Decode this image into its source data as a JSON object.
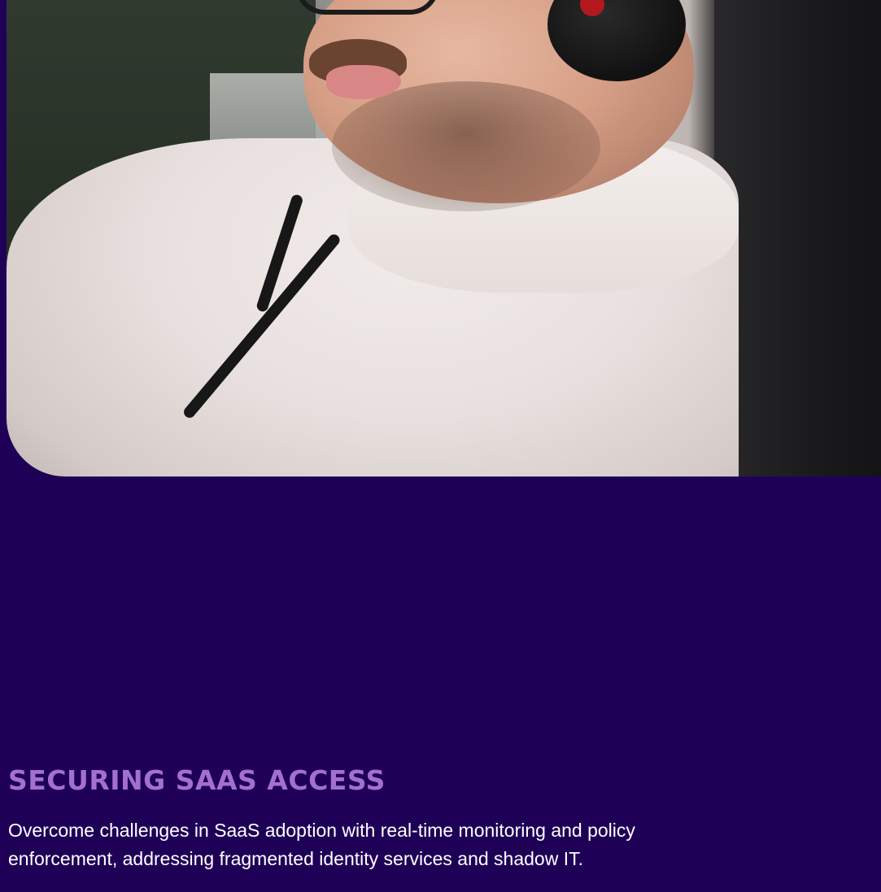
{
  "hero": {
    "image_subject": "person-wearing-headphones-and-hoodie"
  },
  "section": {
    "title": "SECURING SAAS ACCESS",
    "description": "Overcome challenges in SaaS adoption with real-time monitoring and policy enforcement, addressing fragmented identity services and shadow IT."
  },
  "colors": {
    "background": "#1f0057",
    "title": "#a36fd1",
    "text": "#ffffff"
  }
}
